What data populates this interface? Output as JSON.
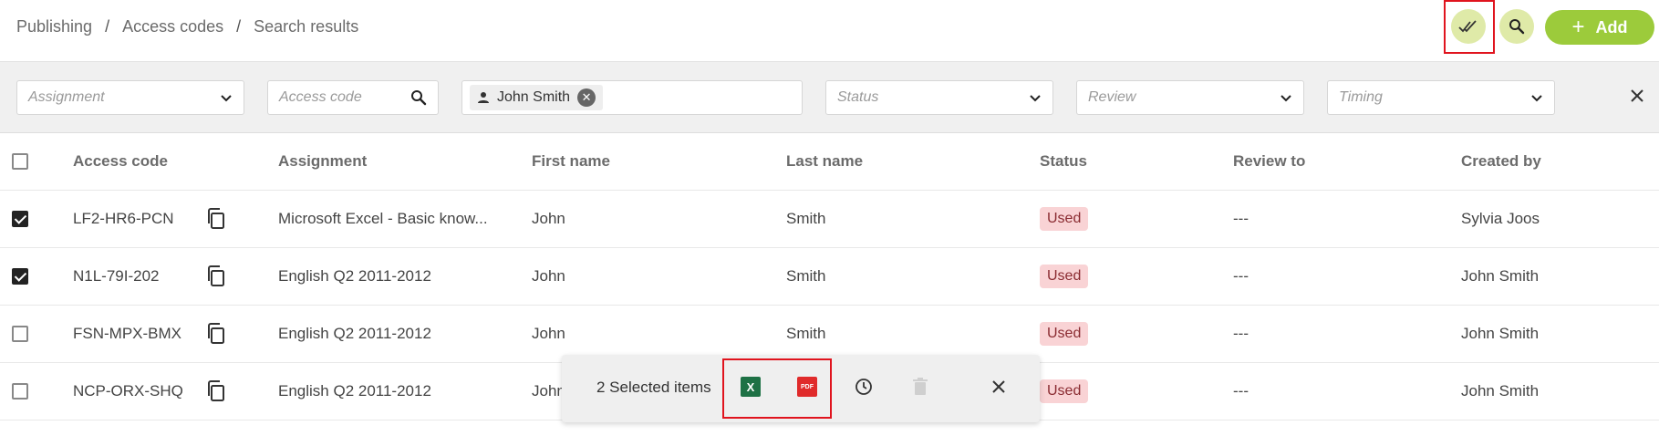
{
  "breadcrumb": [
    "Publishing",
    "Access codes",
    "Search results"
  ],
  "header": {
    "add_label": "Add"
  },
  "filters": {
    "assignment_placeholder": "Assignment",
    "access_code_placeholder": "Access code",
    "person_chip": "John Smith",
    "status_placeholder": "Status",
    "review_placeholder": "Review",
    "timing_placeholder": "Timing"
  },
  "table": {
    "columns": [
      "Access code",
      "Assignment",
      "First name",
      "Last name",
      "Status",
      "Review to",
      "Created by"
    ],
    "rows": [
      {
        "checked": true,
        "code": "LF2-HR6-PCN",
        "assignment": "Microsoft Excel - Basic know...",
        "first": "John",
        "last": "Smith",
        "status": "Used",
        "review": "---",
        "created_by": "Sylvia Joos"
      },
      {
        "checked": true,
        "code": "N1L-79I-202",
        "assignment": "English Q2 2011-2012",
        "first": "John",
        "last": "Smith",
        "status": "Used",
        "review": "---",
        "created_by": "John Smith"
      },
      {
        "checked": false,
        "code": "FSN-MPX-BMX",
        "assignment": "English Q2 2011-2012",
        "first": "John",
        "last": "Smith",
        "status": "Used",
        "review": "---",
        "created_by": "John Smith"
      },
      {
        "checked": false,
        "code": "NCP-ORX-SHQ",
        "assignment": "English Q2 2011-2012",
        "first": "John",
        "last": "",
        "status": "Used",
        "review": "---",
        "created_by": "John Smith"
      }
    ]
  },
  "selection_bar": {
    "count_label": "2 Selected items",
    "excel_icon_text": "X",
    "pdf_icon_text": "PDF"
  },
  "colors": {
    "accent": "#9ccb3b",
    "accent_light": "#dfeaa8",
    "highlight": "#e0141e",
    "used_badge_bg": "#f9d3d5"
  }
}
